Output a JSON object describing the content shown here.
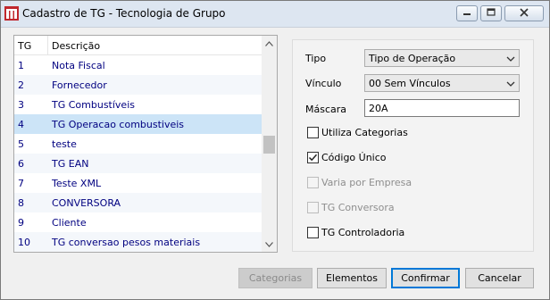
{
  "window": {
    "title": "Cadastro de TG - Tecnologia de Grupo"
  },
  "list": {
    "columns": {
      "tg": "TG",
      "descricao": "Descrição"
    },
    "rows": [
      {
        "tg": "1",
        "descricao": "Nota Fiscal"
      },
      {
        "tg": "2",
        "descricao": "Fornecedor"
      },
      {
        "tg": "3",
        "descricao": "TG Combustíveis"
      },
      {
        "tg": "4",
        "descricao": "TG Operacao combustiveis",
        "selected": true
      },
      {
        "tg": "5",
        "descricao": "teste"
      },
      {
        "tg": "6",
        "descricao": "TG EAN"
      },
      {
        "tg": "7",
        "descricao": "Teste XML"
      },
      {
        "tg": "8",
        "descricao": "CONVERSORA"
      },
      {
        "tg": "9",
        "descricao": "Cliente"
      },
      {
        "tg": "10",
        "descricao": "TG conversao pesos materiais"
      }
    ]
  },
  "form": {
    "tipo_label": "Tipo",
    "tipo_value": "Tipo de Operação",
    "vinculo_label": "Vínculo",
    "vinculo_value": "00 Sem Vínculos",
    "mascara_label": "Máscara",
    "mascara_value": "20A",
    "checkboxes": {
      "utiliza_categorias": {
        "label": "Utiliza Categorias",
        "checked": false,
        "enabled": true
      },
      "codigo_unico": {
        "label": "Código Único",
        "checked": true,
        "enabled": true
      },
      "varia_por_empresa": {
        "label": "Varia por Empresa",
        "checked": false,
        "enabled": false
      },
      "tg_conversora": {
        "label": "TG Conversora",
        "checked": false,
        "enabled": false
      },
      "tg_controladoria": {
        "label": "TG Controladoria",
        "checked": false,
        "enabled": true
      }
    }
  },
  "buttons": {
    "categorias": "Categorias",
    "elementos": "Elementos",
    "confirmar": "Confirmar",
    "cancelar": "Cancelar"
  },
  "colors": {
    "row_text": "#000080",
    "selection": "#cce4f7",
    "accent": "#0078d7"
  }
}
